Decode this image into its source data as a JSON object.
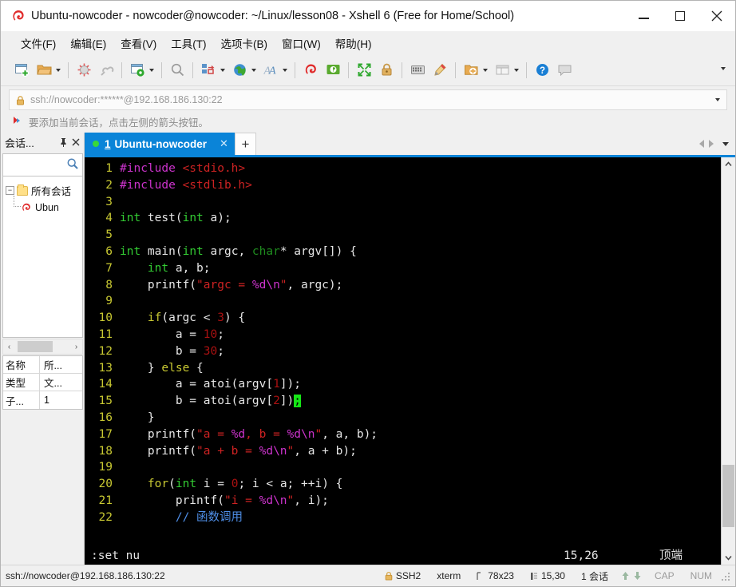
{
  "window": {
    "title": "Ubuntu-nowcoder - nowcoder@nowcoder: ~/Linux/lesson08 - Xshell 6 (Free for Home/School)",
    "app_icon": "xshell-logo-icon",
    "minimize": "minimize-icon",
    "maximize": "maximize-icon",
    "close": "close-icon"
  },
  "menubar": {
    "items": [
      {
        "label": "文件(F)",
        "mnemonic": "F"
      },
      {
        "label": "编辑(E)",
        "mnemonic": "E"
      },
      {
        "label": "查看(V)",
        "mnemonic": "V"
      },
      {
        "label": "工具(T)",
        "mnemonic": "T"
      },
      {
        "label": "选项卡(B)",
        "mnemonic": "B"
      },
      {
        "label": "窗口(W)",
        "mnemonic": "W"
      },
      {
        "label": "帮助(H)",
        "mnemonic": "H"
      }
    ]
  },
  "toolbar": {
    "items": [
      "new-session-icon",
      "open-folder-icon",
      "folder-dropdown-caret",
      "separator",
      "disconnect-icon",
      "reconnect-icon",
      "separator",
      "session-properties-icon",
      "properties-dropdown-caret",
      "separator",
      "find-icon",
      "separator",
      "layout-icon",
      "layout-dropdown-caret",
      "globe-icon",
      "globe-dropdown-caret",
      "font-icon",
      "font-dropdown-caret",
      "separator",
      "xshell-icon",
      "xftp-icon",
      "separator",
      "fullscreen-icon",
      "lock-icon",
      "separator",
      "keyboard-icon",
      "highlight-icon",
      "separator",
      "add-note-icon",
      "note-dropdown-caret",
      "compose-pane-icon",
      "compose-dropdown-caret",
      "separator",
      "help-icon",
      "chat-icon"
    ],
    "overflow": "toolbar-overflow-caret"
  },
  "address_bar": {
    "lock_icon": "lock-icon",
    "value": "ssh://nowcoder:******@192.168.186.130:22",
    "placeholder": "ssh://host",
    "dropdown": "address-dropdown-caret"
  },
  "hint": {
    "icon": "red-arrow-icon",
    "text": "要添加当前会话，点击左侧的箭头按钮。"
  },
  "sidebar": {
    "title": "会话...",
    "pin_icon": "pin-icon",
    "close_icon": "close-icon",
    "search": {
      "value": "",
      "placeholder": "",
      "icon": "search-icon"
    },
    "tree": [
      {
        "label": "所有会话",
        "icon": "folder-icon",
        "expander": "−",
        "level": 0
      },
      {
        "label": "Ubun",
        "icon": "xshell-session-icon",
        "level": 1
      }
    ],
    "hscroll": {
      "left": "‹",
      "right": "›"
    },
    "properties": [
      {
        "key": "名称",
        "value": "所..."
      },
      {
        "key": "类型",
        "value": "文..."
      },
      {
        "key": "子...",
        "value": "1"
      }
    ]
  },
  "tabs": {
    "active": {
      "status_dot": "connected-dot-icon",
      "number": "1",
      "label": "Ubuntu-nowcoder",
      "close": "close-icon"
    },
    "new_tab": "+",
    "nav": {
      "prev": "prev-tab-arrow",
      "next": "next-tab-arrow",
      "list": "tab-list-caret"
    }
  },
  "terminal": {
    "lines": [
      {
        "n": "1",
        "tokens": [
          {
            "t": "#include ",
            "c": "pre"
          },
          {
            "t": "<stdio.h>",
            "c": "inc"
          }
        ]
      },
      {
        "n": "2",
        "tokens": [
          {
            "t": "#include ",
            "c": "pre"
          },
          {
            "t": "<stdlib.h>",
            "c": "inc"
          }
        ]
      },
      {
        "n": "3",
        "tokens": []
      },
      {
        "n": "4",
        "tokens": [
          {
            "t": "int",
            "c": "typ"
          },
          {
            "t": " test(",
            "c": ""
          },
          {
            "t": "int",
            "c": "typ"
          },
          {
            "t": " a);",
            "c": ""
          }
        ]
      },
      {
        "n": "5",
        "tokens": []
      },
      {
        "n": "6",
        "tokens": [
          {
            "t": "int",
            "c": "typ"
          },
          {
            "t": " main(",
            "c": ""
          },
          {
            "t": "int",
            "c": "typ"
          },
          {
            "t": " argc, ",
            "c": ""
          },
          {
            "t": "char",
            "c": "typ2"
          },
          {
            "t": "* argv[]) {",
            "c": ""
          }
        ]
      },
      {
        "n": "7",
        "tokens": [
          {
            "t": "    ",
            "c": ""
          },
          {
            "t": "int",
            "c": "typ"
          },
          {
            "t": " a, b;",
            "c": ""
          }
        ]
      },
      {
        "n": "8",
        "tokens": [
          {
            "t": "    printf(",
            "c": ""
          },
          {
            "t": "\"",
            "c": "str"
          },
          {
            "t": "argc = ",
            "c": "str"
          },
          {
            "t": "%d\\n",
            "c": "esc"
          },
          {
            "t": "\"",
            "c": "str"
          },
          {
            "t": ", argc);",
            "c": ""
          }
        ]
      },
      {
        "n": "9",
        "tokens": []
      },
      {
        "n": "10",
        "tokens": [
          {
            "t": "    ",
            "c": ""
          },
          {
            "t": "if",
            "c": "kw"
          },
          {
            "t": "(argc < ",
            "c": ""
          },
          {
            "t": "3",
            "c": "num"
          },
          {
            "t": ") {",
            "c": ""
          }
        ]
      },
      {
        "n": "11",
        "tokens": [
          {
            "t": "        a = ",
            "c": ""
          },
          {
            "t": "10",
            "c": "num"
          },
          {
            "t": ";",
            "c": ""
          }
        ]
      },
      {
        "n": "12",
        "tokens": [
          {
            "t": "        b = ",
            "c": ""
          },
          {
            "t": "30",
            "c": "num"
          },
          {
            "t": ";",
            "c": ""
          }
        ]
      },
      {
        "n": "13",
        "tokens": [
          {
            "t": "    } ",
            "c": ""
          },
          {
            "t": "else",
            "c": "kw"
          },
          {
            "t": " {",
            "c": ""
          }
        ]
      },
      {
        "n": "14",
        "tokens": [
          {
            "t": "        a = atoi(argv[",
            "c": ""
          },
          {
            "t": "1",
            "c": "num"
          },
          {
            "t": "]);",
            "c": ""
          }
        ]
      },
      {
        "n": "15",
        "tokens": [
          {
            "t": "        b = atoi(argv[",
            "c": ""
          },
          {
            "t": "2",
            "c": "num"
          },
          {
            "t": "])",
            "c": ""
          },
          {
            "t": ";",
            "c": "cursor"
          }
        ]
      },
      {
        "n": "16",
        "tokens": [
          {
            "t": "    }",
            "c": ""
          }
        ]
      },
      {
        "n": "17",
        "tokens": [
          {
            "t": "    printf(",
            "c": ""
          },
          {
            "t": "\"",
            "c": "str"
          },
          {
            "t": "a = ",
            "c": "str"
          },
          {
            "t": "%d",
            "c": "esc"
          },
          {
            "t": ", b = ",
            "c": "str"
          },
          {
            "t": "%d\\n",
            "c": "esc"
          },
          {
            "t": "\"",
            "c": "str"
          },
          {
            "t": ", a, b);",
            "c": ""
          }
        ]
      },
      {
        "n": "18",
        "tokens": [
          {
            "t": "    printf(",
            "c": ""
          },
          {
            "t": "\"",
            "c": "str"
          },
          {
            "t": "a + b = ",
            "c": "str"
          },
          {
            "t": "%d\\n",
            "c": "esc"
          },
          {
            "t": "\"",
            "c": "str"
          },
          {
            "t": ", a + b);",
            "c": ""
          }
        ]
      },
      {
        "n": "19",
        "tokens": []
      },
      {
        "n": "20",
        "tokens": [
          {
            "t": "    ",
            "c": ""
          },
          {
            "t": "for",
            "c": "kw"
          },
          {
            "t": "(",
            "c": ""
          },
          {
            "t": "int",
            "c": "typ"
          },
          {
            "t": " i = ",
            "c": ""
          },
          {
            "t": "0",
            "c": "num"
          },
          {
            "t": "; i < a; ++i) {",
            "c": ""
          }
        ]
      },
      {
        "n": "21",
        "tokens": [
          {
            "t": "        printf(",
            "c": ""
          },
          {
            "t": "\"",
            "c": "str"
          },
          {
            "t": "i = ",
            "c": "str"
          },
          {
            "t": "%d\\n",
            "c": "esc"
          },
          {
            "t": "\"",
            "c": "str"
          },
          {
            "t": ", i);",
            "c": ""
          }
        ]
      },
      {
        "n": "22",
        "tokens": [
          {
            "t": "        ",
            "c": ""
          },
          {
            "t": "// 函数调用",
            "c": "cmt"
          }
        ]
      }
    ],
    "status": {
      "command": ":set nu",
      "position": "15,26",
      "location": "顶端"
    },
    "scrollbar": {
      "up": "scroll-up-arrow",
      "down": "scroll-down-arrow"
    }
  },
  "statusbar": {
    "connection": "ssh://nowcoder@192.168.186.130:22",
    "security": "SSH2",
    "security_icon": "lock-icon",
    "terminal_type": "xterm",
    "size": "78x23",
    "size_icon": "screen-size-icon",
    "cursor": "15,30",
    "cursor_icon": "cursor-pos-icon",
    "sessions": "1 会话",
    "transfer_up": "upload-arrow-icon",
    "transfer_down": "download-arrow-icon",
    "caps": "CAP",
    "num": "NUM",
    "grip": "resize-grip-icon"
  },
  "colors": {
    "accent": "#0a84d8",
    "terminal_bg": "#000000",
    "cursor": "#16e616",
    "linenum": "#c8c832",
    "chrome": "#f0f0f0"
  }
}
